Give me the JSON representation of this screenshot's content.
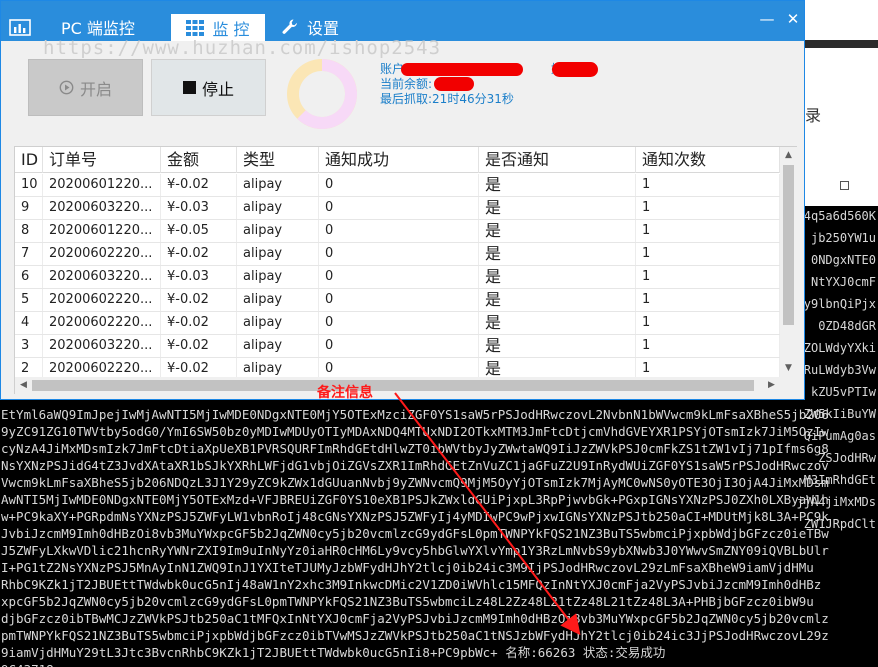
{
  "app": {
    "title": "PC 端监控",
    "tabs": [
      {
        "label": "监 控",
        "icon": "grid-icon"
      },
      {
        "label": "设置",
        "icon": "wrench-icon"
      }
    ],
    "watermark": "https://www.huzhan.com/ishop2543"
  },
  "controls": {
    "start_label": "开启",
    "stop_label": "停止"
  },
  "info": {
    "account_label": "账户:",
    "name_label": "姓名",
    "balance_label": "当前余额:",
    "last_fetch": "最后抓取:21时46分31秒"
  },
  "table": {
    "columns": [
      "ID",
      "订单号",
      "金额",
      "类型",
      "通知成功",
      "是否通知",
      "通知次数"
    ],
    "rows": [
      [
        "10",
        "20200601220...",
        "¥-0.02",
        "alipay",
        "0",
        "是",
        "1"
      ],
      [
        "9",
        "20200603220...",
        "¥-0.03",
        "alipay",
        "0",
        "是",
        "1"
      ],
      [
        "8",
        "20200601220...",
        "¥-0.05",
        "alipay",
        "0",
        "是",
        "1"
      ],
      [
        "7",
        "20200602220...",
        "¥-0.02",
        "alipay",
        "0",
        "是",
        "1"
      ],
      [
        "6",
        "20200603220...",
        "¥-0.03",
        "alipay",
        "0",
        "是",
        "1"
      ],
      [
        "5",
        "20200602220...",
        "¥-0.02",
        "alipay",
        "0",
        "是",
        "1"
      ],
      [
        "4",
        "20200602220...",
        "¥-0.02",
        "alipay",
        "0",
        "是",
        "1"
      ],
      [
        "3",
        "20200603220...",
        "¥-0.02",
        "alipay",
        "0",
        "是",
        "1"
      ],
      [
        "2",
        "20200602220...",
        "¥-0.02",
        "alipay",
        "0",
        "是",
        "1"
      ]
    ]
  },
  "annotation": {
    "label": "备注信息"
  },
  "background": {
    "record_text": "录",
    "right_fragments": [
      "4q5a6d560K",
      "jb250YW1u",
      "0NDgxNTE0",
      "NtYXJ0cmF",
      "Qy9lbnQiPjx",
      "0ZD48dGR",
      "ZOLWdyYXki",
      "RuLWdyb3Vw",
      "kZU5vPTIw",
      "ZW5kIiBuYW",
      "QiPumAg0as",
      "ZSJodHRw",
      "M3ImRhdGEt",
      "jjA4jiMxMDs",
      "ZW1JRpdClt"
    ],
    "console_lines": [
      "EtYml6aWQ9ImJpejIwMjAwNTI5MjIwMDE0NDgxNTE0MjY5OTExMzciZGF0YS1saW5rPSJodHRwczovL2NvbnN1bWVwcm9kLmFsaXBheS5jb206",
      "9yZC91ZG10TWVtby5odG0/YmI6SW50bz0yMDIwMDUyOTIyMDAxNDQ4MTUxNDI2OTkxMTM3JmFtcDtjcmVhdGVEYXR1PSYjOTsmIzk7JiM5OzIw",
      "cyNzA4JiMxMDsmIzk7JmFtcDtiaXpUeXB1PVRSQURFImRhdGEtdHlwZT0ibWVtbyJyZWwtaWQ9IiJzZWVkPSJ0cmFkZS1tZW1vIj71pIfms6g8",
      "NsYXNzPSJidG4tZ3JvdXAtaXR1bSJkYXRhLWFjdG1vbjOiZGVsZXR1ImRhdGEtZnVuZC1jaGFuZ2U9InRydWUiZGF0YS1saW5rPSJodHRwczov",
      "Vwcm9kLmFsaXBheS5jb206NDQzL3J1Y29yZC9kZWx1dGUuanNvbj9yZWNvcmQ9MjM5OyYjOTsmIzk7MjAyMC0wNS0yOTE3OjI3OjA4JiMxMDsm",
      "AwNTI5MjIwMDE0NDgxNTE0MjY5OTExMzd+VFJBREUiZGF0YS10eXB1PSJkZWxldGUiPjxpL3RpPjwvbGk+PGxpIGNsYXNzPSJ0ZXh0LXByaW1h",
      "w+PC9kaXY+PGRpdmNsYXNzPSJ5ZWFyLW1vbnRoIj48cGNsYXNzPSJ5ZWFyIj4yMDIwPC9wPjxwIGNsYXNzPSJtb250aCI+MDUtMjk8L3A+PC9k",
      "JvbiJzcmM9Imh0dHBzOi8vb3MuYWxpcGF5b2JqZWN0cy5jb20vcmlzcG9ydGFsL0pmTWNPYkFQS21NZ3BuTS5wbmciPjxpbWdjbGFzcz0ieTBw",
      "J5ZWFyLXkwVDlic21hcnRyYWNrZXI9Im9uInNyYz0iaHR0cHM6Ly9vcy5hbGlwYXlvYmp1Y3RzLmNvbS9ybXNwb3J0YWwvSmZNY09iQVBLbUlr",
      "I+PG1tZ2NsYXNzPSJ5MnAyInN1ZWQ9InJ1YXIteTJUMyJzbWFydHJhY2tlcj0ib24ic3M9IjPSJodHRwczovL29zLmFsaXBheW9iamVjdHMu",
      "RhbC9KZk1jT2JBUEttTWdwbk0ucG5nIj48aW1nY2xhc3M9InkwcDMic2V1ZD0iWVhlc15MFQzInNtYXJ0cmFja2VyPSJvbiJzcmM9Imh0dHBz",
      "xpcGF5b2JqZWN0cy5jb20vcmlzcG9ydGFsL0pmTWNPYkFQS21NZ3BuTS5wbmciLz48L2Zz48L21tZz48L21tZz48L3A+PHBjbGFzcz0ibW9u",
      "djbGFzcz0ibTBwMCJzZWVkPSJtb250aC1tMFQxInNtYXJ0cmFja2VyPSJvbiJzcmM9Imh0dHBzOi8vb3MuYWxpcGF5b2JqZWN0cy5jb20vcmlz",
      "pmTWNPYkFQS21NZ3BuTS5wbmciPjxpbWdjbGFzcz0ibTVwMSJzZWVkPSJtb250aC1tNSJzbWFydHJhY2tlcj0ib24ic3JjPSJodHRwczovL29z",
      "9iamVjdHMuY29tL3Jtc3BvcnRhbC9KZk1jT2JBUEttTWdwbk0ucG5nIi8+PC9pbWc+ 名称:66263 状态:交易成功",
      "9C43718"
    ]
  },
  "colors": {
    "titlebar": "#2a8ddc",
    "info_text": "#1a7ec9",
    "annotation_red": "#ff1a1a",
    "redaction": "#f20000",
    "donut_a": "#f7d9f7",
    "donut_b": "#fbe6b5"
  }
}
